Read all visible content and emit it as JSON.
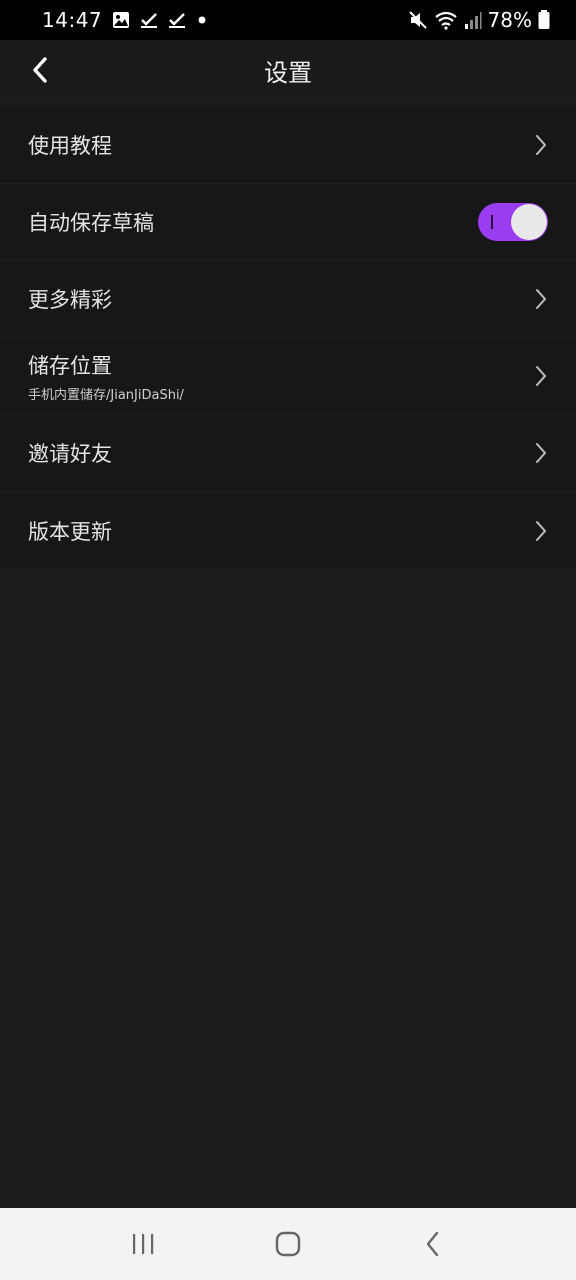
{
  "status_bar": {
    "time": "14:47",
    "battery_percent": "78%",
    "icons": [
      "image-icon",
      "check-icon",
      "check-icon",
      "dot-icon",
      "mute-icon",
      "wifi-icon",
      "signal-icon",
      "battery-icon"
    ]
  },
  "header": {
    "title": "设置"
  },
  "settings": {
    "items": [
      {
        "label": "使用教程",
        "type": "link"
      },
      {
        "label": "自动保存草稿",
        "type": "toggle",
        "enabled": true
      },
      {
        "label": "更多精彩",
        "type": "link"
      },
      {
        "label": "储存位置",
        "sublabel": "手机内置储存/JianJiDaShi/",
        "type": "link"
      },
      {
        "label": "邀请好友",
        "type": "link"
      },
      {
        "label": "版本更新",
        "type": "link"
      }
    ]
  },
  "colors": {
    "toggle_on": "#9a3cf0",
    "background": "#1c1c1c",
    "list_background": "#171717"
  },
  "nav_bar": {
    "buttons": [
      "recents-icon",
      "home-icon",
      "back-icon"
    ]
  }
}
